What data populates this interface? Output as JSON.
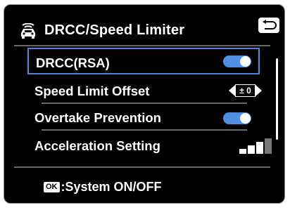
{
  "header": {
    "title": "DRCC/Speed Limiter",
    "icon": "car-radar-icon",
    "back_icon": "return-icon"
  },
  "menu": {
    "items": [
      {
        "label": "DRCC(RSA)",
        "control": "toggle",
        "state": "on",
        "selected": true
      },
      {
        "label": "Speed Limit Offset",
        "control": "stepper",
        "value": "± 0"
      },
      {
        "label": "Overtake Prevention",
        "control": "toggle",
        "state": "on"
      },
      {
        "label": "Acceleration Setting",
        "control": "level",
        "level": 3,
        "max_level": 4
      }
    ]
  },
  "footer": {
    "badge": "OK",
    "text": ":System ON/OFF"
  },
  "colors": {
    "background": "#000000",
    "accent": "#4f8fe6",
    "selection": "#4f83d6",
    "divider": "#666666"
  }
}
